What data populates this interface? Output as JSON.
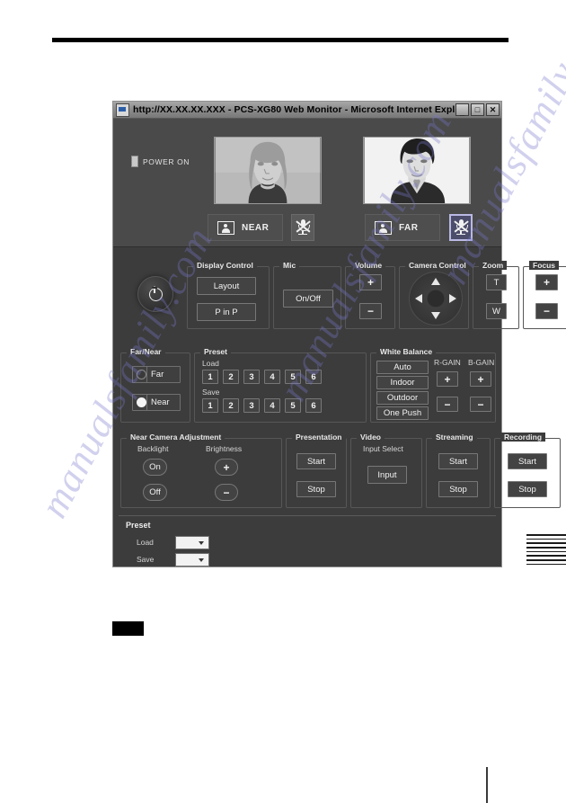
{
  "window": {
    "title": "http://XX.XX.XX.XXX - PCS-XG80 Web Monitor - Microsoft Internet Expl...",
    "icon": "ie-page-icon",
    "buttons": {
      "minimize": "_",
      "maximize": "□",
      "close": "✕"
    }
  },
  "video": {
    "power_status": "POWER ON",
    "near": {
      "label": "NEAR",
      "icon": "person-monitor-icon",
      "mic_icon": "mic-muted-icon",
      "mic_selected": false
    },
    "far": {
      "label": "FAR",
      "icon": "person-monitor-icon",
      "mic_icon": "mic-muted-icon",
      "mic_selected": true
    }
  },
  "controls": {
    "power_button_icon": "power-icon",
    "display_control": {
      "title": "Display Control",
      "layout": "Layout",
      "pinp": "P in P"
    },
    "mic": {
      "title": "Mic",
      "onoff": "On/Off"
    },
    "volume": {
      "title": "Volume",
      "plus": "+",
      "minus": "−"
    },
    "camera_control": {
      "title": "Camera Control",
      "dpad_icon": "dpad-icon"
    },
    "zoom": {
      "title": "Zoom",
      "tele": "T",
      "wide": "W"
    },
    "focus": {
      "title": "Focus",
      "plus": "+",
      "minus": "−"
    },
    "far_near": {
      "title": "Far/Near",
      "far": "Far",
      "near": "Near",
      "selected": "Near"
    },
    "preset": {
      "title": "Preset",
      "load_label": "Load",
      "save_label": "Save",
      "numbers": [
        "1",
        "2",
        "3",
        "4",
        "5",
        "6"
      ]
    },
    "white_balance": {
      "title": "White Balance",
      "auto": "Auto",
      "indoor": "Indoor",
      "outdoor": "Outdoor",
      "one_push": "One Push",
      "r_gain_label": "R-GAIN",
      "b_gain_label": "B-GAIN",
      "plus": "+",
      "minus": "−"
    },
    "near_camera_adjustment": {
      "title": "Near Camera Adjustment",
      "backlight_label": "Backlight",
      "backlight_on": "On",
      "backlight_off": "Off",
      "brightness_label": "Brightness",
      "plus": "+",
      "minus": "−"
    },
    "presentation": {
      "title": "Presentation",
      "start": "Start",
      "stop": "Stop"
    },
    "video_group": {
      "title": "Video",
      "input_select_label": "Input Select",
      "input": "Input"
    },
    "streaming": {
      "title": "Streaming",
      "start": "Start",
      "stop": "Stop"
    },
    "recording": {
      "title": "Recording",
      "start": "Start",
      "stop": "Stop"
    },
    "preset_bottom": {
      "title": "Preset",
      "load_label": "Load",
      "save_label": "Save",
      "load_value": "",
      "save_value": ""
    }
  },
  "watermark": {
    "line1": "manualsfamily.com",
    "line2": "manualsfamily.com",
    "line3": "manualsfamily.com"
  }
}
